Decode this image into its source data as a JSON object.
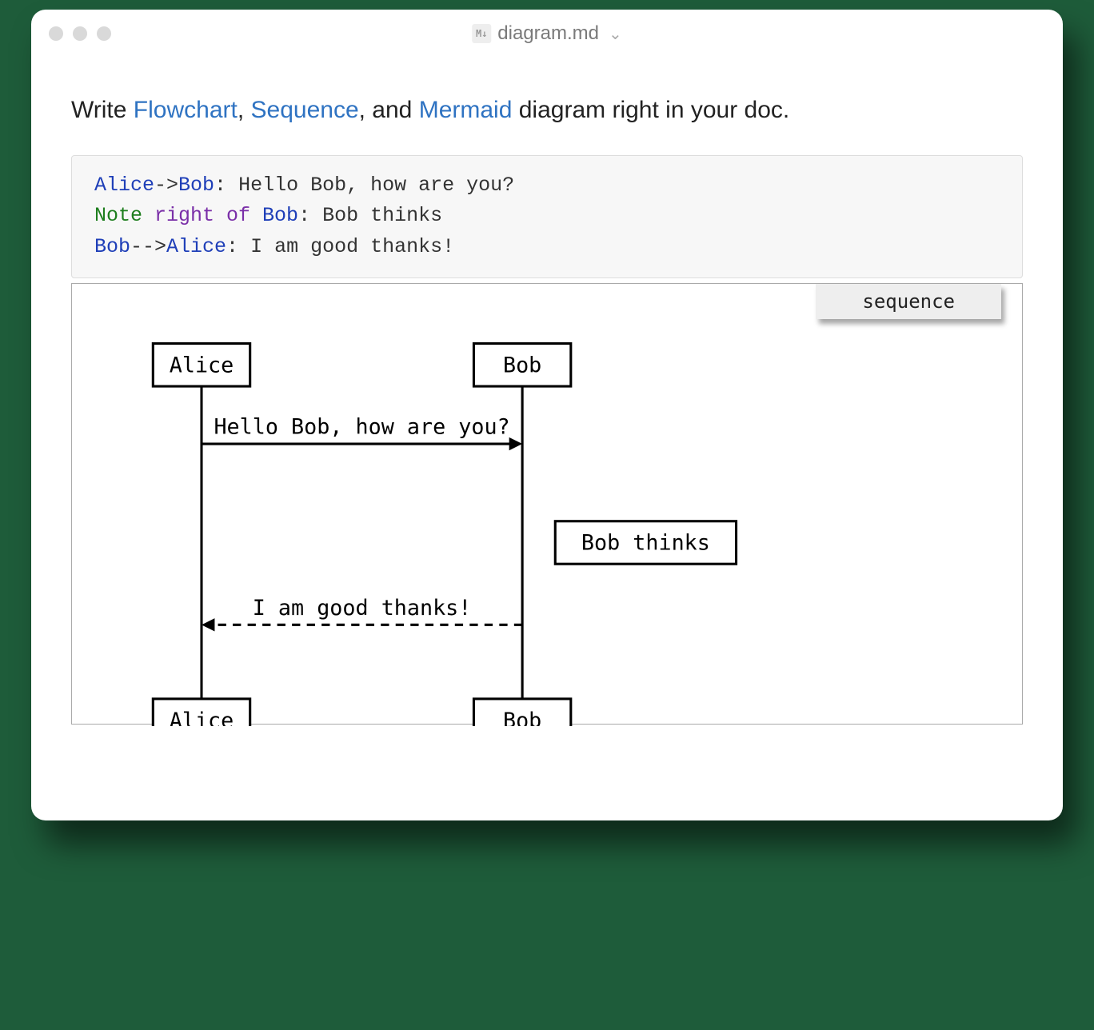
{
  "window": {
    "title": "diagram.md",
    "icon_label": "M↓"
  },
  "intro": {
    "prefix": "Write ",
    "links": [
      "Flowchart",
      "Sequence",
      "Mermaid"
    ],
    "mid1": ", ",
    "mid2": ", and ",
    "suffix": " diagram right in your doc."
  },
  "code": {
    "line1": {
      "actor1": "Alice",
      "arrow": "->",
      "actor2": "Bob",
      "colon": ":",
      "msg": " Hello Bob, how are you?"
    },
    "line2": {
      "kw": "Note",
      "pos": " right of ",
      "actor": "Bob",
      "colon": ":",
      "msg": " Bob thinks"
    },
    "line3": {
      "actor1": "Bob",
      "arrow": "-->",
      "actor2": "Alice",
      "colon": ":",
      "msg": " I am good thanks!"
    }
  },
  "diagram": {
    "type_label": "sequence"
  },
  "chart_data": {
    "type": "sequence",
    "actors": [
      "Alice",
      "Bob"
    ],
    "events": [
      {
        "kind": "message",
        "from": "Alice",
        "to": "Bob",
        "style": "solid",
        "text": "Hello Bob, how are you?"
      },
      {
        "kind": "note",
        "actor": "Bob",
        "position": "right",
        "text": "Bob thinks"
      },
      {
        "kind": "message",
        "from": "Bob",
        "to": "Alice",
        "style": "dashed",
        "text": "I am good thanks!"
      }
    ]
  }
}
